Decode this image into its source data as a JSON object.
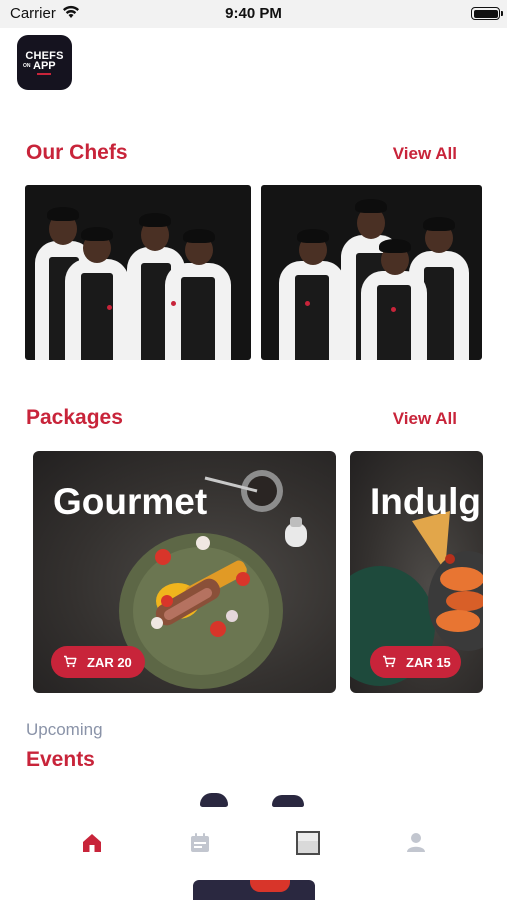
{
  "status_bar": {
    "carrier": "Carrier",
    "time": "9:40 PM",
    "icons": [
      "wifi-icon",
      "battery-icon"
    ]
  },
  "app": {
    "logo": {
      "line1": "CHEFS",
      "line2": "ON",
      "line3": "APP"
    }
  },
  "our_chefs": {
    "title": "Our Chefs",
    "view_all": "View All"
  },
  "packages": {
    "title": "Packages",
    "view_all": "View All",
    "items": [
      {
        "name": "Gourmet",
        "price": "ZAR 20"
      },
      {
        "name": "Indulg",
        "price": "ZAR 15"
      }
    ]
  },
  "events": {
    "subtitle": "Upcoming",
    "title": "Events"
  },
  "tab_bar": {
    "tabs": [
      {
        "icon": "home-icon",
        "active": true
      },
      {
        "icon": "calendar-icon",
        "active": false
      },
      {
        "icon": "gallery-icon",
        "active": false
      },
      {
        "icon": "profile-icon",
        "active": false
      }
    ]
  },
  "colors": {
    "accent": "#c8243a",
    "muted": "#8a93a8",
    "logo_bg": "#15131f"
  }
}
